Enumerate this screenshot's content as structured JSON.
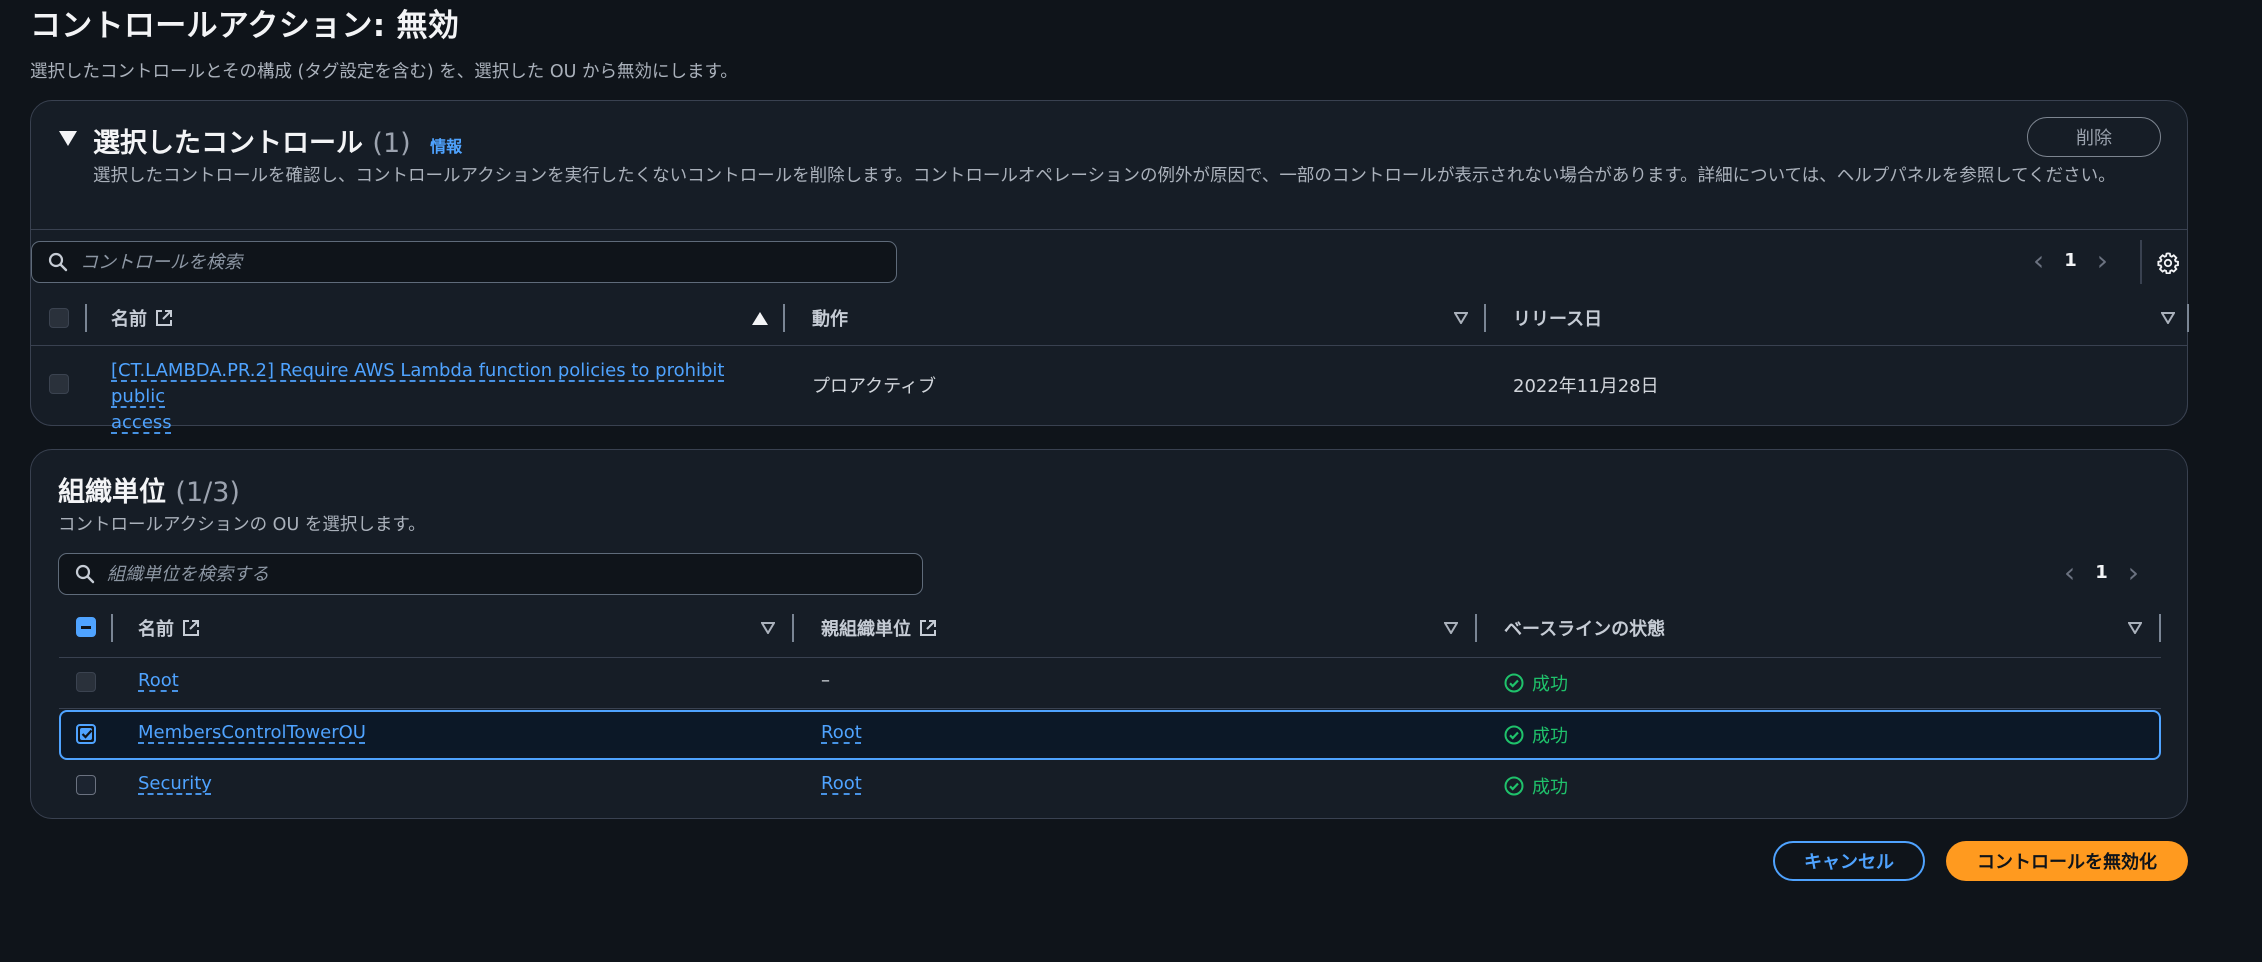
{
  "page": {
    "title": "コントロールアクション: 無効",
    "description": "選択したコントロールとその構成 (タグ設定を含む) を、選択した OU から無効にします。"
  },
  "controls_panel": {
    "title": "選択したコントロール",
    "count": "(1)",
    "info": "情報",
    "description": "選択したコントロールを確認し、コントロールアクションを実行したくないコントロールを削除します。コントロールオペレーションの例外が原因で、一部のコントロールが表示されない場合があります。詳細については、ヘルプパネルを参照してください。",
    "delete_label": "削除",
    "search_placeholder": "コントロールを検索",
    "page_number": "1",
    "columns": [
      "名前",
      "動作",
      "リリース日"
    ],
    "rows": [
      {
        "name": "[CT.LAMBDA.PR.2] Require AWS Lambda function policies to prohibit public access",
        "name_line1": "[CT.LAMBDA.PR.2] Require AWS Lambda function policies to prohibit public",
        "name_line2": "access",
        "behavior": "プロアクティブ",
        "release_date": "2022年11月28日"
      }
    ]
  },
  "ou_panel": {
    "title": "組織単位",
    "count": "(1/3)",
    "description": "コントロールアクションの OU を選択します。",
    "search_placeholder": "組織単位を検索する",
    "page_number": "1",
    "columns": [
      "名前",
      "親組織単位",
      "ベースラインの状態"
    ],
    "rows": [
      {
        "name": "Root",
        "parent": "–",
        "status": "成功",
        "selected": false,
        "disabled": true
      },
      {
        "name": "MembersControlTowerOU",
        "parent": "Root",
        "status": "成功",
        "selected": true,
        "disabled": false
      },
      {
        "name": "Security",
        "parent": "Root",
        "status": "成功",
        "selected": false,
        "disabled": false
      }
    ]
  },
  "footer": {
    "cancel_label": "キャンセル",
    "disable_label": "コントロールを無効化"
  },
  "colors": {
    "accent": "#4fa3ff",
    "primary_button": "#ff9a1f",
    "success": "#1fc26b",
    "background": "#0f141a"
  }
}
